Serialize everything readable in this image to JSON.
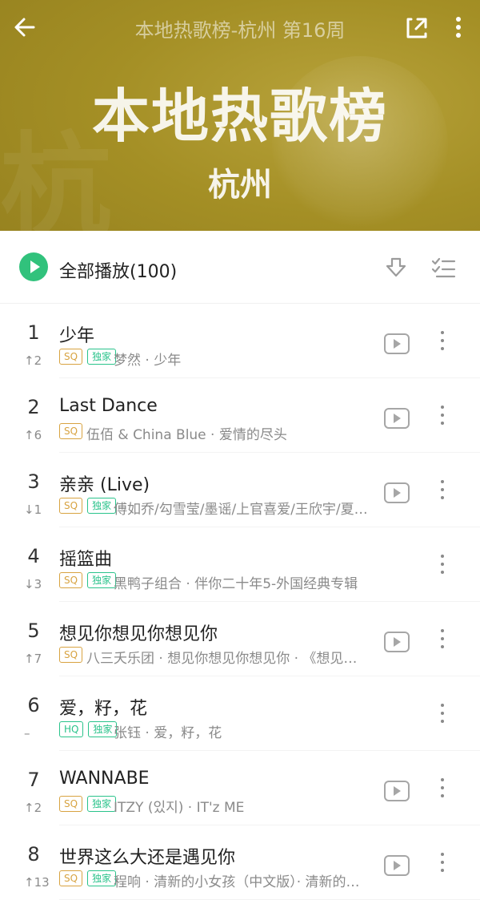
{
  "header": {
    "top_title": "本地热歌榜-杭州  第16周",
    "main_title": "本地热歌榜",
    "sub_title": "杭州",
    "watermark": "杭"
  },
  "play_all": {
    "label": "全部播放(100)"
  },
  "songs": [
    {
      "rank": "1",
      "title": "少年",
      "trend": "↑2",
      "badges": [
        "SQ",
        "独家"
      ],
      "meta": "梦然 · 少年",
      "mv": true
    },
    {
      "rank": "2",
      "title": "Last Dance",
      "trend": "↑6",
      "badges": [
        "SQ"
      ],
      "meta": "伍佰 & China Blue · 爱情的尽头",
      "mv": true
    },
    {
      "rank": "3",
      "title": "亲亲 (Live)",
      "trend": "↓1",
      "badges": [
        "SQ",
        "独家"
      ],
      "meta": "傅如乔/勾雪莹/墨谣/上官喜爱/王欣宇/夏…",
      "mv": true
    },
    {
      "rank": "4",
      "title": "摇篮曲",
      "trend": "↓3",
      "badges": [
        "SQ",
        "独家"
      ],
      "meta": "黑鸭子组合 · 伴你二十年5-外国经典专辑",
      "mv": false
    },
    {
      "rank": "5",
      "title": "想见你想见你想见你",
      "trend": "↑7",
      "badges": [
        "SQ"
      ],
      "meta": "八三夭乐团 · 想见你想见你想见你 · 《想见…",
      "mv": true
    },
    {
      "rank": "6",
      "title": "爱，籽，花",
      "trend": "–",
      "badges": [
        "HQ",
        "独家"
      ],
      "meta": "张钰 · 爱，籽，花",
      "mv": false
    },
    {
      "rank": "7",
      "title": "WANNABE",
      "trend": "↑2",
      "badges": [
        "SQ",
        "独家"
      ],
      "meta": "ITZY (있지) · IT'z ME",
      "mv": true
    },
    {
      "rank": "8",
      "title": "世界这么大还是遇见你",
      "trend": "↑13",
      "badges": [
        "SQ",
        "独家"
      ],
      "meta": "程响 · 清新的小女孩（中文版）· 清新的…",
      "mv": true
    }
  ],
  "icons": {
    "back": "back-arrow-icon",
    "share": "share-icon",
    "more": "more-vertical-icon",
    "play_all": "play-circle-icon",
    "download": "download-icon",
    "multiselect": "multiselect-icon",
    "mv": "mv-play-icon"
  },
  "colors": {
    "accent": "#31c27c",
    "sq": "#d8a341",
    "exclusive": "#2ac38b"
  }
}
